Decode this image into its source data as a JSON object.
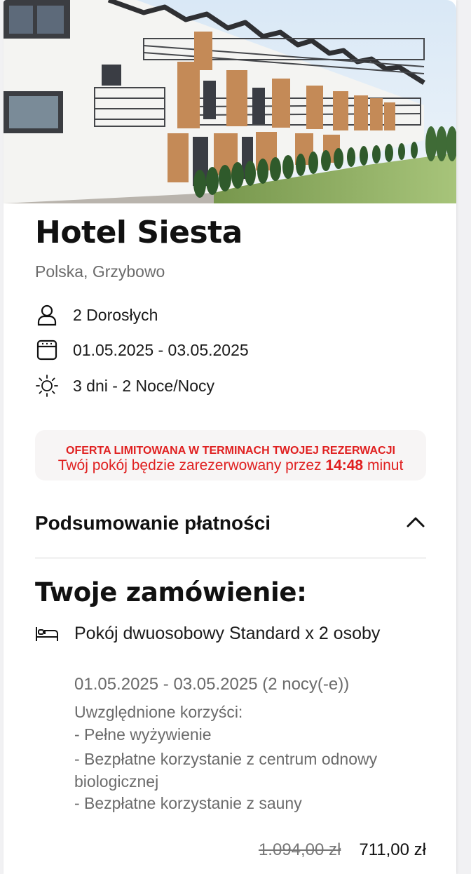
{
  "hotel": {
    "name": "Hotel Siesta",
    "location": "Polska, Grzybowo",
    "guests": "2 Dorosłych",
    "dates": "01.05.2025 - 03.05.2025",
    "duration": "3 dni - 2 Noce/Nocy"
  },
  "offer": {
    "headline": "OFERTA LIMITOWANA W TERMINACH TWOJEJ REZERWACJI",
    "message_prefix": "Twój pokój będzie zarezerwowany przez",
    "timer": "14:48",
    "message_suffix": "minut"
  },
  "summary": {
    "label": "Podsumowanie płatności"
  },
  "order": {
    "title": "Twoje zamówienie:",
    "room_name": "Pokój dwuosobowy Standard x 2 osoby",
    "room_dates": "01.05.2025 - 03.05.2025 (2 nocy(-e))",
    "benefits_heading": "Uwzględnione korzyści:",
    "benefit_1": "- Pełne wyżywienie",
    "benefit_2": "- Bezpłatne korzystanie z centrum odnowy biologicznej",
    "benefit_3": "- Bezpłatne korzystanie z sauny",
    "old_price": "1.094,00 zł",
    "new_price": "711,00 zł"
  },
  "icons": {
    "guests": "person-icon",
    "dates": "calendar-icon",
    "duration": "sun-icon",
    "summary_toggle": "chevron-up-icon",
    "room": "bed-icon"
  },
  "colors": {
    "accent_red": "#e02020",
    "muted_text": "#6b6b6b",
    "offer_bg": "#f7f5f5"
  }
}
